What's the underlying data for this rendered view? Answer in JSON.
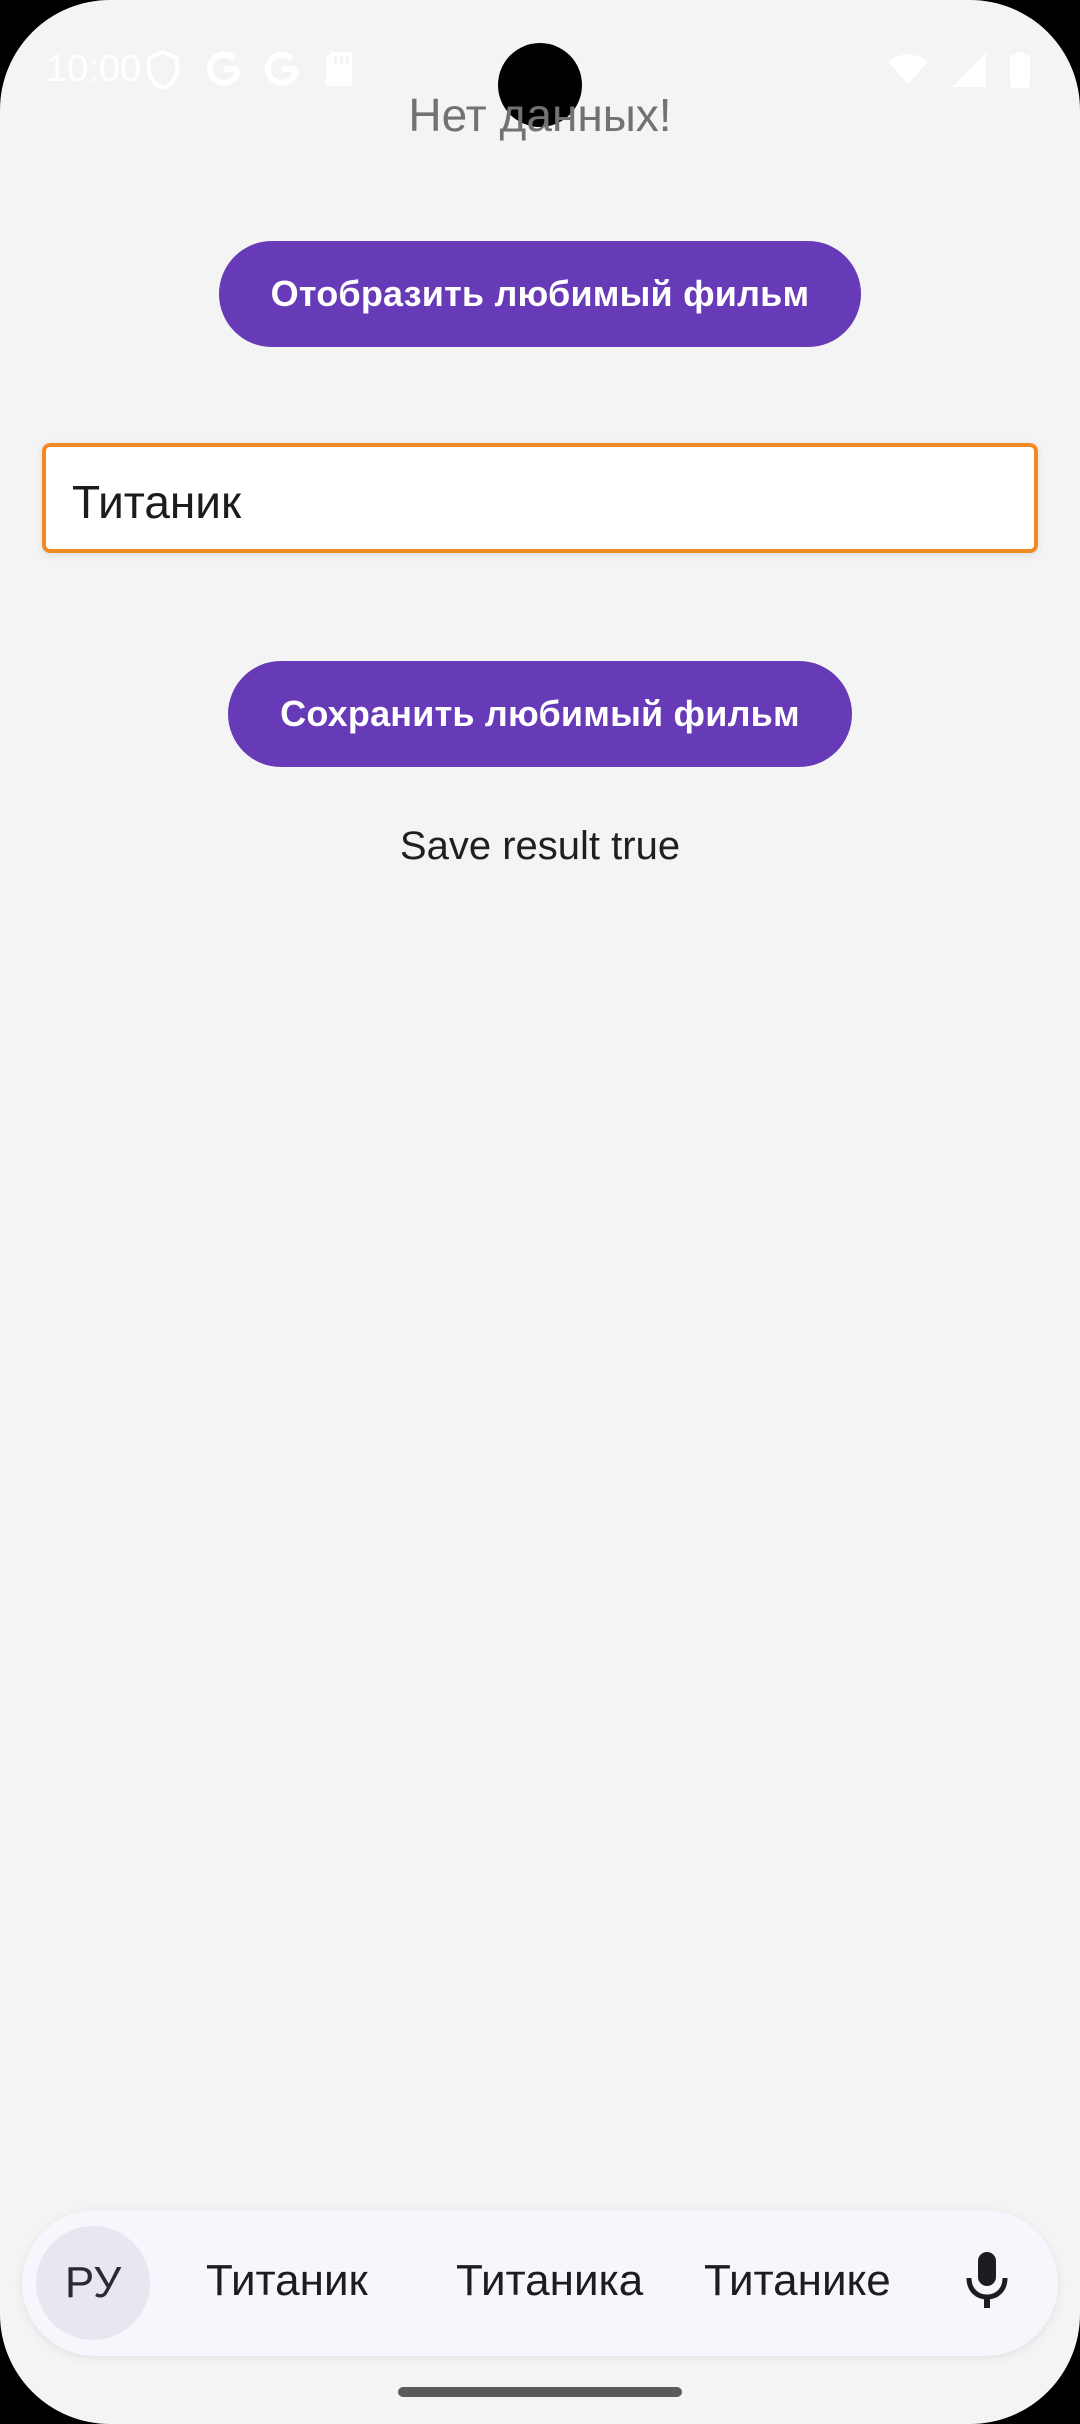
{
  "status_bar": {
    "time": "10:00",
    "icons_left": [
      "shield-icon",
      "google-icon",
      "google-icon",
      "sd-card-icon"
    ],
    "icons_right": [
      "wifi-icon",
      "signal-icon",
      "battery-icon"
    ]
  },
  "header": {
    "text": "Нет данных!"
  },
  "show_button": {
    "label": "Отобразить любимый фильм"
  },
  "movie_input": {
    "value": "Титаник"
  },
  "save_button": {
    "label": "Сохранить любимый фильм"
  },
  "result": {
    "text": "Save result true"
  },
  "keyboard": {
    "language": "РУ",
    "suggestions": [
      "Титаник",
      "Титаника",
      "Титанике"
    ],
    "mic_icon": "mic-icon"
  },
  "colors": {
    "accent": "#673ab7",
    "input_border": "#f08a24",
    "background": "#f4f4f4"
  }
}
